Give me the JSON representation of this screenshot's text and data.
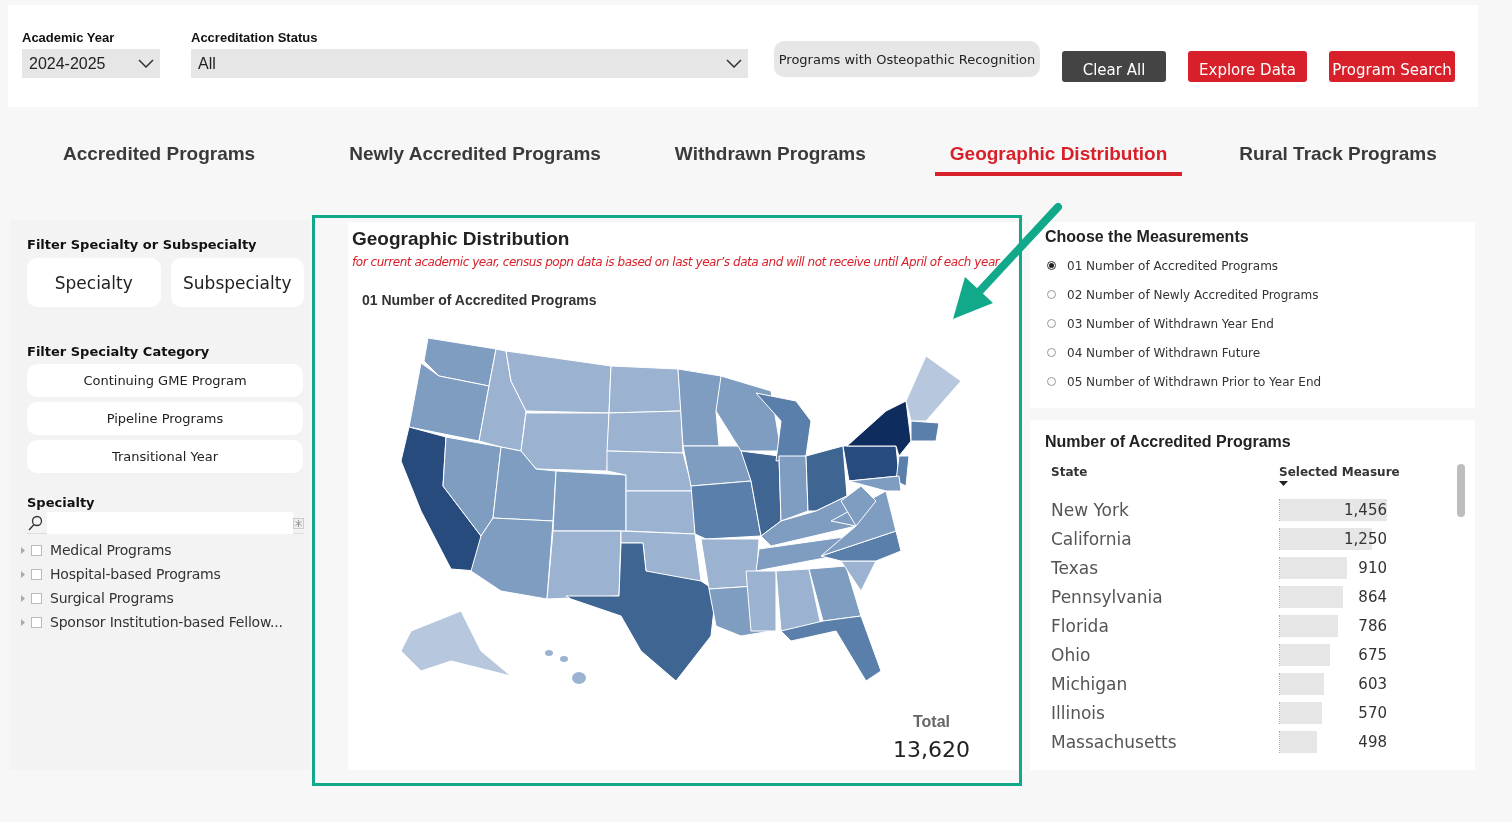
{
  "filters": {
    "academic_year": {
      "label": "Academic Year",
      "value": "2024-2025"
    },
    "accreditation_status": {
      "label": "Accreditation Status",
      "value": "All"
    }
  },
  "toggle_button": {
    "label": "Programs with Osteopathic Recognition"
  },
  "buttons": [
    {
      "label": "Clear All",
      "kind": "dark"
    },
    {
      "label": "Explore Data",
      "kind": "red"
    },
    {
      "label": "Program Search",
      "kind": "red"
    }
  ],
  "tabs": [
    {
      "label": "Accredited Programs",
      "selected": false
    },
    {
      "label": "Newly Accredited Programs",
      "selected": false
    },
    {
      "label": "Withdrawn Programs",
      "selected": false
    },
    {
      "label": "Geographic Distribution",
      "selected": true
    },
    {
      "label": "Rural Track Programs",
      "selected": false
    }
  ],
  "sidebar": {
    "specialty_filter": {
      "title": "Filter Specialty or Subspecialty",
      "options": [
        "Specialty",
        "Subspecialty"
      ]
    },
    "category_filter": {
      "title": "Filter Specialty Category",
      "options": [
        "Continuing GME Program",
        "Pipeline Programs",
        "Transitional Year"
      ]
    },
    "specialty_list": {
      "title": "Specialty",
      "items": [
        {
          "label": "Medical Programs",
          "checked": false
        },
        {
          "label": "Hospital-based Programs",
          "checked": false
        },
        {
          "label": "Surgical Programs",
          "checked": false
        },
        {
          "label": "Sponsor Institution-based Fellow...",
          "checked": false
        }
      ]
    }
  },
  "map_card": {
    "title": "Geographic Distribution",
    "note": "for current academic year, census popn data is based on last year’s data and will not receive until April of each year.",
    "subtitle": "01 Number of Accredited Programs",
    "total_label": "Total",
    "total_value": "13,620"
  },
  "measurements": {
    "title": "Choose the Measurements",
    "options": [
      {
        "label": "01 Number of Accredited Programs",
        "selected": true
      },
      {
        "label": "02 Number of Newly Accredited Programs",
        "selected": false
      },
      {
        "label": "03 Number of Withdrawn Year End",
        "selected": false
      },
      {
        "label": "04 Number of Withdrawn Future",
        "selected": false
      },
      {
        "label": "05 Number of Withdrawn Prior to Year End",
        "selected": false
      }
    ]
  },
  "state_table": {
    "title": "Number of Accredited Programs",
    "columns": [
      "State",
      "Selected Measure"
    ],
    "rows": [
      {
        "state": "New York",
        "value": "1,456",
        "level": 1
      },
      {
        "state": "California",
        "value": "1,250",
        "level": 0.859
      },
      {
        "state": "Texas",
        "value": "910",
        "level": 0.625
      },
      {
        "state": "Pennsylvania",
        "value": "864",
        "level": 0.593
      },
      {
        "state": "Florida",
        "value": "786",
        "level": 0.54
      },
      {
        "state": "Ohio",
        "value": "675",
        "level": 0.464
      },
      {
        "state": "Michigan",
        "value": "603",
        "level": 0.414
      },
      {
        "state": "Illinois",
        "value": "570",
        "level": 0.391
      },
      {
        "state": "Massachusetts",
        "value": "498",
        "level": 0.342
      }
    ]
  }
}
